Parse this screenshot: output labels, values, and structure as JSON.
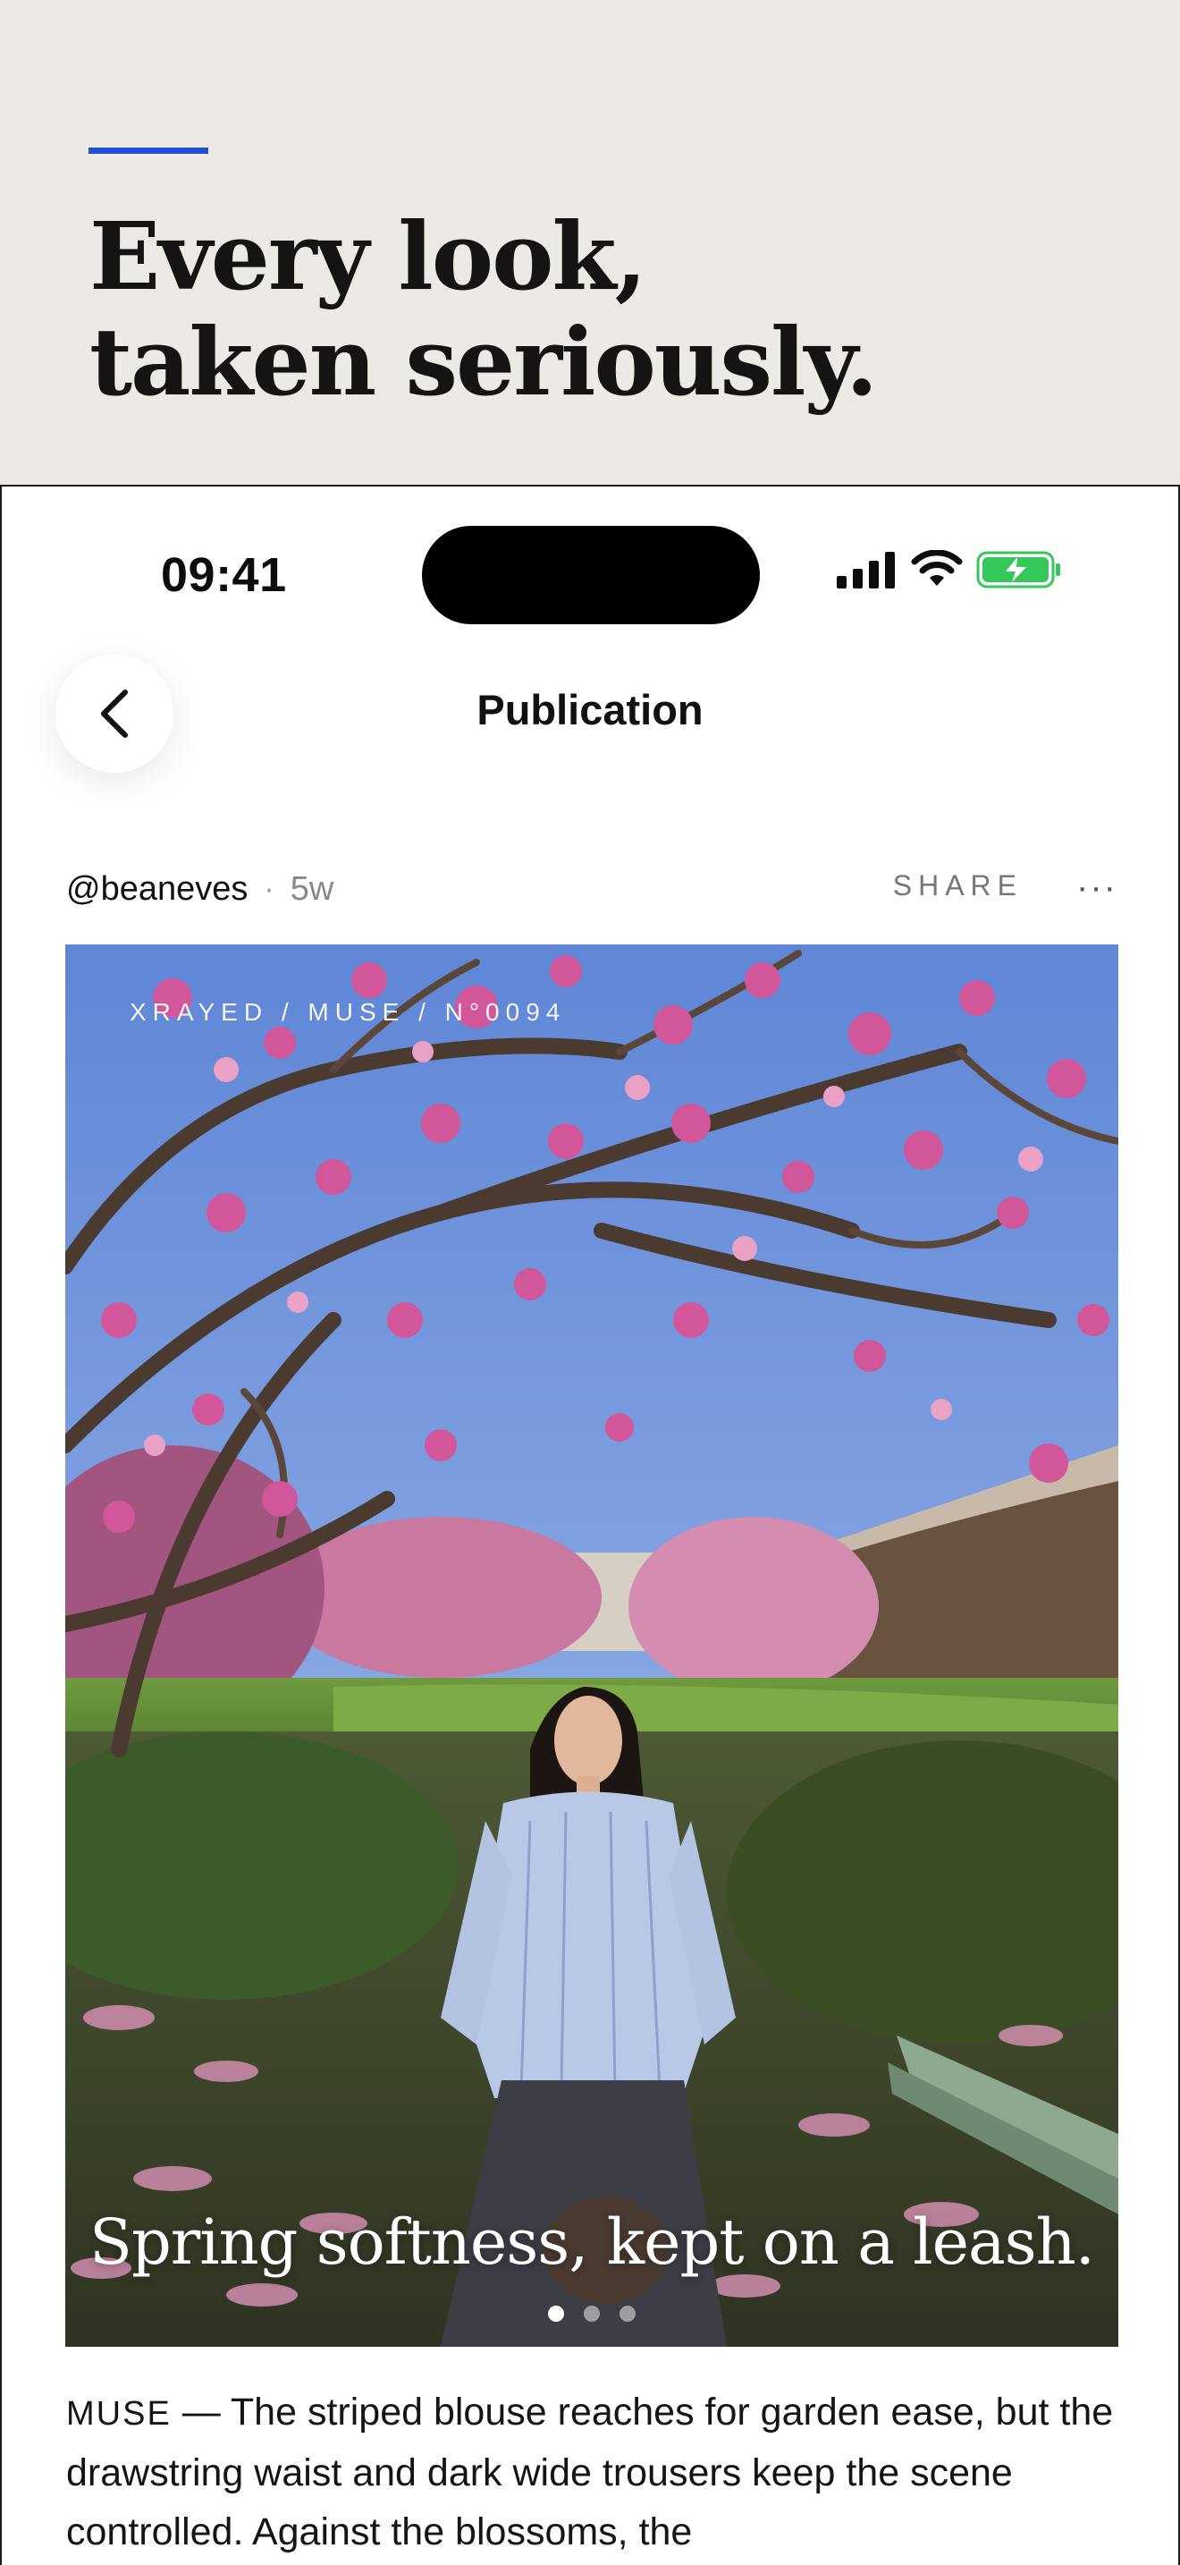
{
  "hero": {
    "title": "Every look,\ntaken seriously.",
    "accent_color": "#1f4fd8"
  },
  "status_bar": {
    "time": "09:41",
    "icons": [
      "cellular-signal-icon",
      "wifi-icon",
      "battery-charging-icon"
    ],
    "battery_color": "#34c759"
  },
  "nav": {
    "back_icon": "chevron-left-icon",
    "title": "Publication"
  },
  "post": {
    "author": "@beaneves",
    "separator": "·",
    "age": "5w",
    "share_label": "SHARE",
    "more_label": "···",
    "kicker": "XRAYED / MUSE / N°0094",
    "caption": "Spring softness, kept on a leash.",
    "carousel": {
      "count": 3,
      "active_index": 0
    },
    "body_tag": "MUSE",
    "body_text": " — The striped blouse reaches for garden ease, but the drawstring waist and dark wide trousers keep the scene controlled. Against the blossoms, the"
  }
}
